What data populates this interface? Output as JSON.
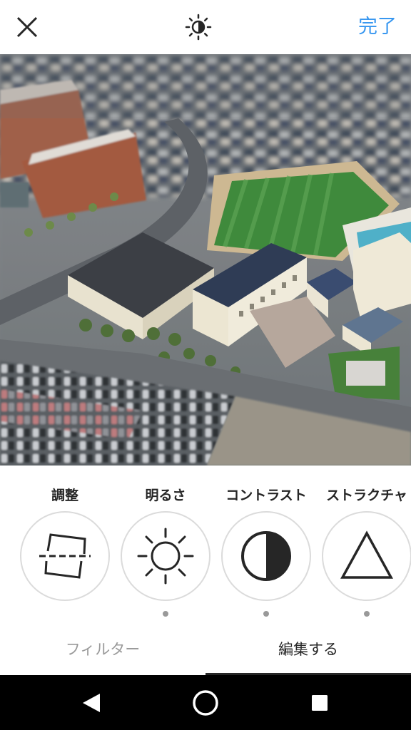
{
  "top_bar": {
    "close_icon": "close-icon",
    "lux_icon": "brightness-lux-icon",
    "done_label": "完了",
    "accent_color": "#3897f0"
  },
  "photo": {
    "description_icon": "photo-preview"
  },
  "tools": [
    {
      "label": "調整",
      "icon": "adjust-icon"
    },
    {
      "label": "明るさ",
      "icon": "brightness-icon"
    },
    {
      "label": "コントラスト",
      "icon": "contrast-icon"
    },
    {
      "label": "ストラクチャ",
      "icon": "structure-icon"
    }
  ],
  "tabs": {
    "filter_label": "フィルター",
    "edit_label": "編集する",
    "active": "edit"
  },
  "navbar": {
    "back_icon": "back-triangle-icon",
    "home_icon": "home-circle-icon",
    "recents_icon": "recents-square-icon"
  }
}
